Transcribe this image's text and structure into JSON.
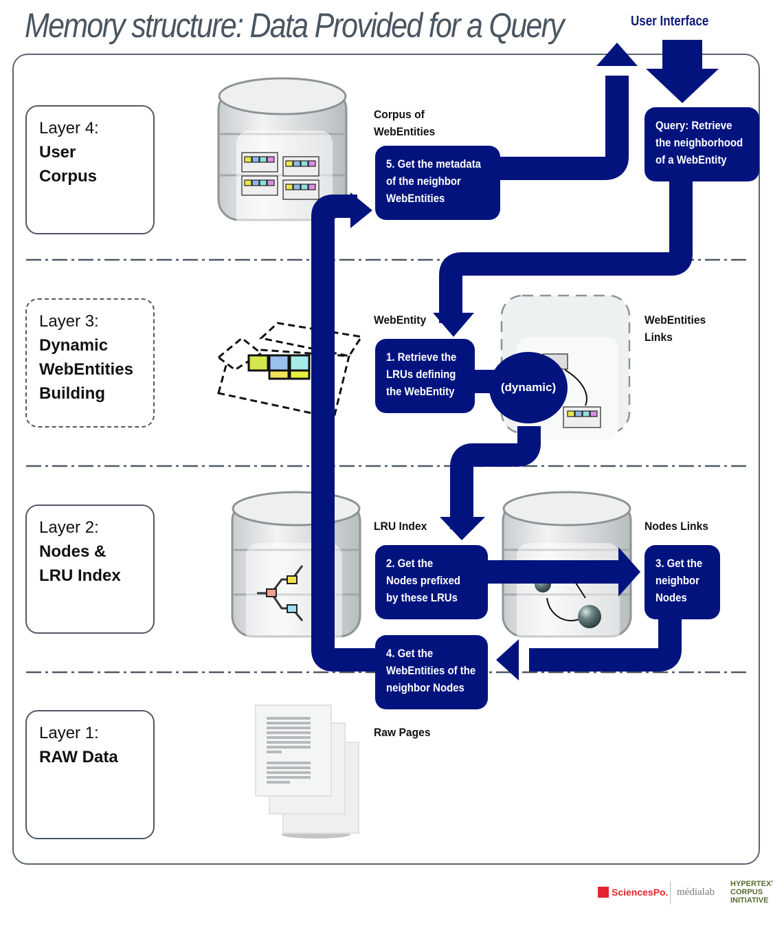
{
  "title": "Memory structure: Data Provided for a Query",
  "user_interface_label": "User Interface",
  "colors": {
    "flow": "#03137e",
    "frame": "#5a6470",
    "title": "#4a5560",
    "sciencespo": "#e3262e",
    "hci": "#556b2f"
  },
  "layers": [
    {
      "head": "Layer 4:",
      "name_lines": [
        "User",
        "Corpus"
      ],
      "border": "solid"
    },
    {
      "head": "Layer 3:",
      "name_lines": [
        "Dynamic",
        "WebEntities",
        "Building"
      ],
      "border": "dash-dot"
    },
    {
      "head": "Layer 2:",
      "name_lines": [
        "Nodes &",
        "LRU Index"
      ],
      "border": "solid"
    },
    {
      "head": "Layer 1:",
      "name_lines": [
        "RAW Data"
      ],
      "border": "solid"
    }
  ],
  "store_labels": {
    "corpus": [
      "Corpus of",
      "WebEntities"
    ],
    "webentity": "WebEntity",
    "webentities_links": [
      "WebEntities",
      "Links"
    ],
    "lru_index": "LRU Index",
    "nodes_links": "Nodes Links",
    "raw_pages": "Raw Pages"
  },
  "steps": {
    "query": [
      "Query: Retrieve",
      "the neighborhood",
      "of a WebEntity"
    ],
    "s1": [
      "1. Retrieve the",
      "LRUs defining",
      "the WebEntity"
    ],
    "dynamic": "(dynamic)",
    "s2": [
      "2. Get the",
      "Nodes prefixed",
      "by these LRUs"
    ],
    "s3": [
      "3. Get the",
      "neighbor",
      "Nodes"
    ],
    "s4": [
      "4. Get the",
      "WebEntities of the",
      "neighbor Nodes"
    ],
    "s5": [
      "5. Get the metadata",
      "of the neighbor",
      "WebEntities"
    ]
  },
  "icons": {
    "corpus_db": "database-with-boxes-icon",
    "webentity_box": "open-box-icon",
    "webentities_links_db": "dashed-database-icon",
    "lru_db": "database-tree-icon",
    "nodes_db": "database-graph-icon",
    "raw_pages": "document-stack-icon"
  },
  "footer": {
    "sciencespo": "SciencesPo.",
    "medialab": "médialab",
    "hci": [
      "HYPERTEXT",
      "CORPUS",
      "INITIATIVE"
    ]
  }
}
